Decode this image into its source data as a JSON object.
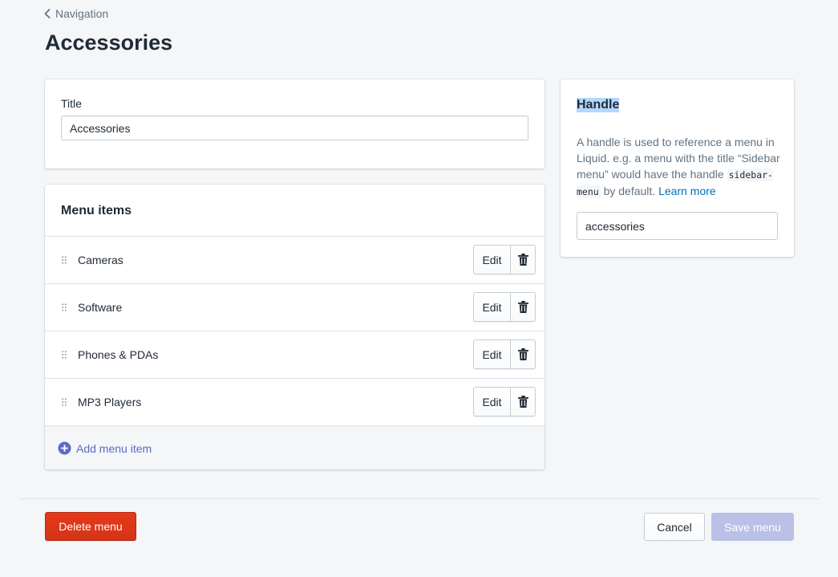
{
  "breadcrumb": {
    "label": "Navigation",
    "icon": "chevron-left-icon"
  },
  "page": {
    "title": "Accessories"
  },
  "title_card": {
    "label": "Title",
    "value": "Accessories"
  },
  "menu_items": {
    "heading": "Menu items",
    "edit_label": "Edit",
    "items": [
      {
        "label": "Cameras"
      },
      {
        "label": "Software"
      },
      {
        "label": "Phones & PDAs"
      },
      {
        "label": "MP3 Players"
      }
    ],
    "add_label": "Add menu item"
  },
  "handle": {
    "heading": "Handle",
    "desc_part1": "A handle is used to reference a menu in Liquid. e.g. a menu with the title “Sidebar menu” would have the handle ",
    "desc_code": "sidebar-menu",
    "desc_part2": " by default. ",
    "learn_more": "Learn more",
    "value": "accessories"
  },
  "footer": {
    "delete_label": "Delete menu",
    "cancel_label": "Cancel",
    "save_label": "Save menu"
  },
  "colors": {
    "accent": "#5c6ac4",
    "danger": "#de3618",
    "link": "#006fbb",
    "save_disabled": "#bac0e6",
    "selection_highlight": "#b3d7fe"
  }
}
